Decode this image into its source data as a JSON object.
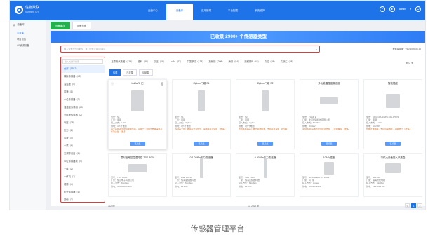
{
  "brand": {
    "name": "信物数联",
    "subtitle": "Sunthing IOT"
  },
  "nav": [
    "运营中心",
    "设备库",
    "应用管理",
    "平台配置",
    "系统维护"
  ],
  "nav_active": 1,
  "user": {
    "name": "admin"
  },
  "sidebar": {
    "head": "设备库",
    "items": [
      "平台库",
      "项目设备",
      "AR资源设备"
    ],
    "active": 0
  },
  "tabs": [
    "设备库存",
    "设备搜索"
  ],
  "banner": "已收录 2900+ 个传感器类型",
  "search": {
    "placeholder": "输入设备型号/编码/厂家 | 搜索关键词/描述",
    "right": "数据库版本：V2.2 2020-05-10"
  },
  "filter_label": "全部品牌",
  "brands": [
    "全部",
    "华为（600）",
    "正泰电气集团（429）",
    "德科（58）",
    "汉王（18）",
    "LoRa（22）",
    "中国移动（133）",
    "施耐德（208）",
    "海康（84）",
    "施耐德B（42）",
    "力控（88）",
    "艾默生（38）"
  ],
  "sort": "默认",
  "cat_search": "输入关键字搜索",
  "categories": [
    "全部（1937）",
    "模拟传感器（48）",
    "温湿度（4）",
    "风速（1）",
    "水位传感器（3）",
    "温湿度传感器（25）",
    "光照度传感器（2）",
    "气压（28）",
    "压力（2）",
    "水浸（4）",
    "水质（6）",
    "空调等设备（1）",
    "水位传感器类（4）",
    "土壤（2）",
    "一体机（7）",
    "烟感（4）",
    "红外传感器（1）",
    "其他（2）"
  ],
  "subtabs": [
    "传感",
    "已采集",
    "待采集"
  ],
  "cards": [
    {
      "title": "LoRaT8 纪",
      "rows": [
        "型号：S1",
        "厂家：南钢",
        "接入方式：LoRa",
        "供电：4节干电池"
      ],
      "desc": "基于LoRa技术的远距离传感，适用于工业场景数据采集与传输设备",
      "btn": "已采集",
      "hl": true
    },
    {
      "title": "Zigbee门磁 S1",
      "rows": [
        "型号：S1",
        "厂家：南钢",
        "接入方式：zigbee",
        "供电：3节干电池"
      ],
      "desc": "ZigBee无线门磁感应开关信号，需网关接入使用",
      "btn": "已采集",
      "hl": false
    },
    {
      "title": "Zigbee门磁 S2",
      "rows": [
        "型号：S2",
        "厂家：南钢",
        "接入方式：zigbee",
        "供电：3节干电池"
      ],
      "desc": "低功耗ZigBee门磁开关量检测，支持平台采集",
      "btn": "已采集",
      "hl": false
    },
    {
      "title": "多功能温湿度变送器",
      "rows": [
        "型号：THM0 E",
        "厂家：北京智联科技有限公司",
        "接入方式：Modbus",
        "供电：DC12V"
      ],
      "desc": "485/Modbus通讯温湿度变送器，工业级精度",
      "btn": "已采集",
      "hl": false
    },
    {
      "title": "智能插座",
      "rows": [
        "型号：CPU 10A-1/SP9-10A-1/SP2",
        "厂家：南钢",
        "接入方式：LoRa",
        "供电：AC220V"
      ],
      "desc": "智能计量插座，支持远程通断，功率统计",
      "btn": "已采集",
      "hl": false
    },
    {
      "title": "模拟信号量温湿传感 TRS-3000",
      "rows": [
        "型号：TRS 3M00",
        "厂家：恒山电子有限公司",
        "接入方式：Modbus",
        "供电：4~20mA/0~10V"
      ],
      "desc": "",
      "btn": "",
      "hl": false
    },
    {
      "title": "0-1.0MPa压力变送器",
      "rows": [
        "型号：FNE 1MPa",
        "厂家：恒海变频器科技",
        "接入方式：Modbus",
        "供电：24VDC"
      ],
      "desc": "",
      "btn": "",
      "hl": false
    },
    {
      "title": "0-50kPa压力变送器",
      "rows": [
        "型号：SBE P300",
        "厂家：恒海变频器科技",
        "接入方式：Modbus",
        "供电：24VDC"
      ],
      "desc": "",
      "btn": "",
      "hl": false
    },
    {
      "title": "10A六插座",
      "rows": [
        "型号：S1 Max E10 V4 10A 2",
        "厂家：A厂家",
        "接入方式：zigbee",
        "供电：AC110~240V"
      ],
      "desc": "",
      "btn": "",
      "hl": false
    },
    {
      "title": "口供大设备接入采集盒",
      "rows": [
        "型号：IMS 310",
        "厂家：恒海智能电网",
        "接入方式：Modbus",
        "供电：12V~24V DC"
      ],
      "desc": "",
      "btn": "",
      "hl": false
    }
  ],
  "more_label": "【更多】",
  "footer": {
    "left": "共20条",
    "center": "共 2922 条",
    "pages": [
      "<",
      "1",
      ">"
    ],
    "active_page": 1
  },
  "caption": "传感器管理平台"
}
